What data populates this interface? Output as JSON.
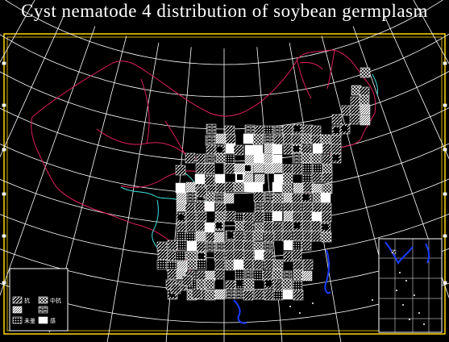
{
  "title": "Cyst nematode 4 distribution of soybean germplasm",
  "colors": {
    "background": "#000000",
    "frame": "#ffd700",
    "graticule": "#ffffff",
    "province_border": "#e0205a",
    "river": "#40e0e0",
    "sea_coast": "#1a3cff",
    "hatch": "#ffffff"
  },
  "legend": {
    "items": [
      {
        "pattern": "diagonal",
        "label": "抗"
      },
      {
        "pattern": "cross",
        "label": "中抗"
      },
      {
        "pattern": "dense",
        "label": ""
      },
      {
        "pattern": "brick",
        "label": ""
      },
      {
        "pattern": "dots",
        "label": "未鉴"
      },
      {
        "pattern": "solid",
        "label": "感"
      }
    ]
  }
}
